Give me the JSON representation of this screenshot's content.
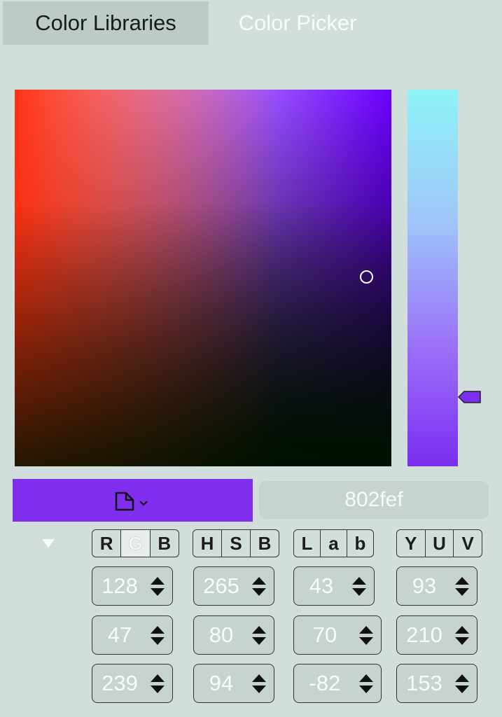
{
  "tabs": [
    {
      "label": "Color Libraries"
    },
    {
      "label": "Color Picker"
    }
  ],
  "picker": {
    "hue_value": 265,
    "saturation": 80,
    "brightness": 94,
    "swatch_color": "#802fef",
    "swatch_icon": "document-icon",
    "swatch_dropdown_icon": "chevron-down-icon"
  },
  "hex": {
    "value": "802fef"
  },
  "collapse_icon": "triangle-down-icon",
  "modes": [
    {
      "letters": [
        "R",
        "G",
        "B"
      ],
      "active_index": 1
    },
    {
      "letters": [
        "H",
        "S",
        "B"
      ],
      "active_index": -1
    },
    {
      "letters": [
        "L",
        "a",
        "b"
      ],
      "active_index": -1
    },
    {
      "letters": [
        "Y",
        "U",
        "V"
      ],
      "active_index": -1
    }
  ],
  "values": {
    "rgb": [
      "128",
      "47",
      "239"
    ],
    "hsb": [
      "265",
      "80",
      "94"
    ],
    "lab": [
      "43",
      "70",
      "-82"
    ],
    "yuv": [
      "93",
      "210",
      "153"
    ]
  }
}
